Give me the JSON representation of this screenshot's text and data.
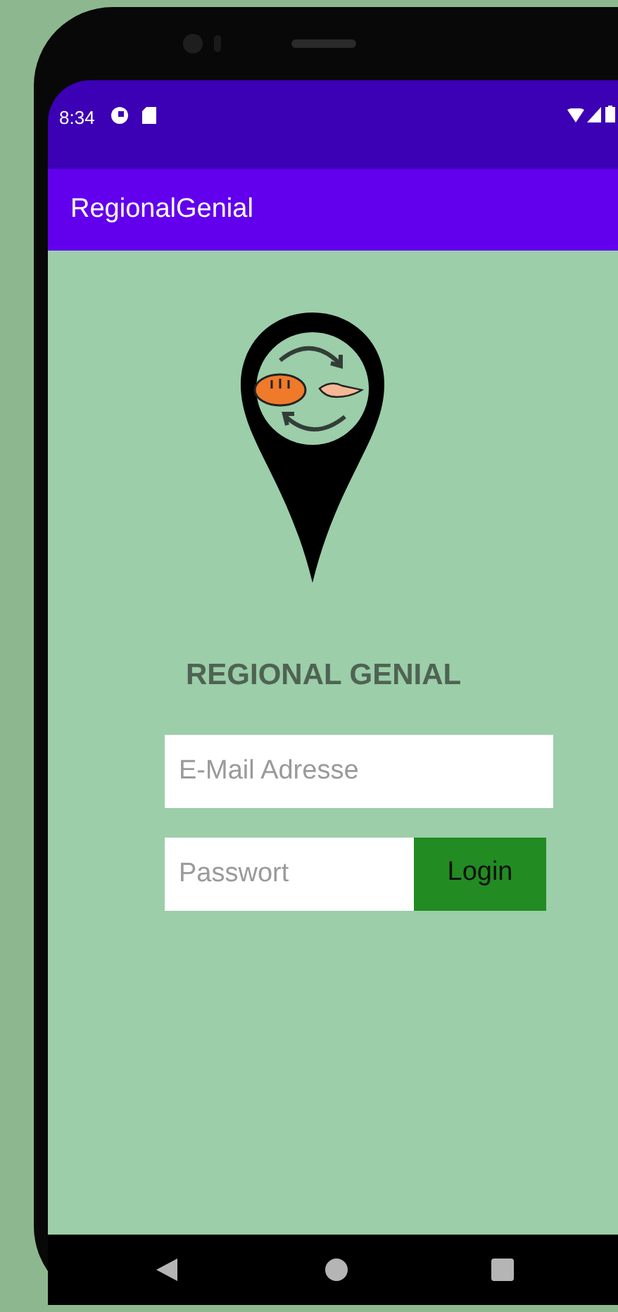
{
  "status_bar": {
    "time": "8:34"
  },
  "app_bar": {
    "title": "RegionalGenial"
  },
  "heading": "REGIONAL GENIAL",
  "email_field": {
    "placeholder": "E-Mail Adresse"
  },
  "password_field": {
    "placeholder": "Passwort"
  },
  "login_button": "Login"
}
